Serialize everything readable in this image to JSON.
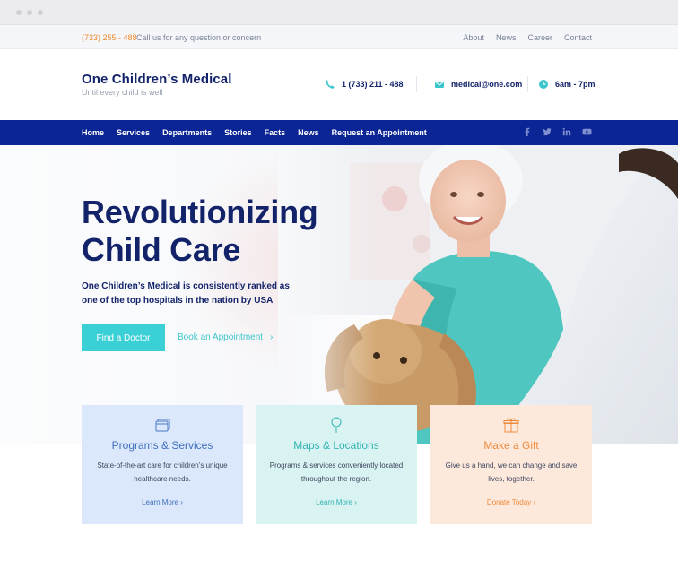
{
  "topbar": {
    "phone": "(733) 255 - 488",
    "note": "Call us for any question or concern",
    "links": [
      "About",
      "News",
      "Career",
      "Contact"
    ]
  },
  "brand": {
    "name": "One Children’s Medical",
    "tagline": "Until every child is well"
  },
  "contact": {
    "phone": "1 (733) 211 - 488",
    "email": "medical@one.com",
    "hours": "6am - 7pm"
  },
  "nav": {
    "items": [
      "Home",
      "Services",
      "Departments",
      "Stories",
      "Facts",
      "News",
      "Request an Appointment"
    ],
    "social": [
      "facebook-icon",
      "twitter-icon",
      "linkedin-icon",
      "youtube-icon"
    ]
  },
  "hero": {
    "title_line1": "Revolutionizing",
    "title_line2": "Child Care",
    "lead": "One Children’s Medical is consistently ranked as one of the top hospitals in the nation by USA",
    "primary_button": "Find a Doctor",
    "secondary_button": "Book an Appointment"
  },
  "cards": [
    {
      "title": "Programs & Services",
      "desc": "State-of-the-art care for children’s unique healthcare needs.",
      "link": "Learn More",
      "icon": "programs-icon"
    },
    {
      "title": "Maps & Locations",
      "desc": "Programs & services conveniently located throughout the region.",
      "link": "Learn More",
      "icon": "map-pin-icon"
    },
    {
      "title": "Make a Gift",
      "desc": "Give us a hand, we can change and save lives, together.",
      "link": "Donate Today",
      "icon": "gift-icon"
    }
  ],
  "colors": {
    "brand_navy": "#13236a",
    "nav_blue": "#0b2594",
    "accent_teal": "#3bd0d6",
    "accent_orange": "#f08a2a"
  }
}
